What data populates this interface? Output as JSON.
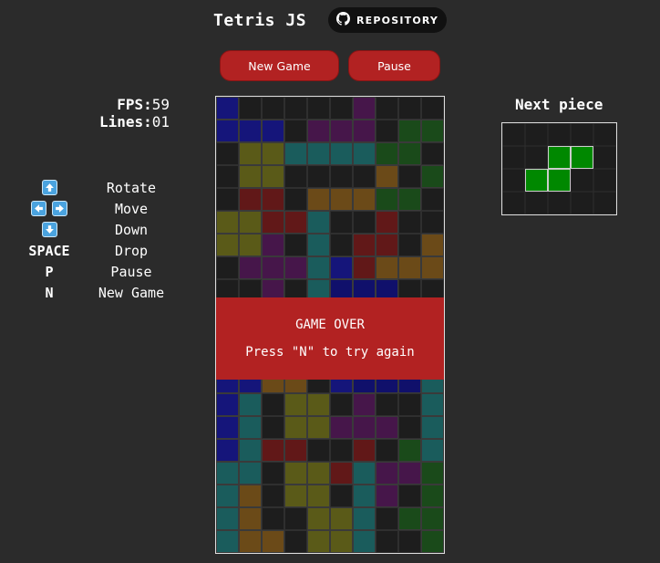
{
  "header": {
    "title": "Tetris JS",
    "repo_label": "REPOSITORY",
    "repo_icon": "github-icon"
  },
  "controls": {
    "new_game_label": "New Game",
    "pause_label": "Pause"
  },
  "stats": {
    "fps_label": "FPS:",
    "fps_value": "59",
    "lines_label": "Lines:",
    "lines_value": "01"
  },
  "keys": [
    {
      "key": "",
      "icons": [
        "arrow-up-icon"
      ],
      "action": "Rotate"
    },
    {
      "key": "",
      "icons": [
        "arrow-left-icon",
        "arrow-right-icon"
      ],
      "action": "Move"
    },
    {
      "key": "",
      "icons": [
        "arrow-down-icon"
      ],
      "action": "Down"
    },
    {
      "key": "SPACE",
      "icons": [],
      "action": "Drop"
    },
    {
      "key": "P",
      "icons": [],
      "action": "Pause"
    },
    {
      "key": "N",
      "icons": [],
      "action": "New Game"
    }
  ],
  "game_over": {
    "title": "GAME OVER",
    "message": "Press \"N\" to try again"
  },
  "next_piece": {
    "title": "Next piece",
    "shape": "S",
    "color": "#008800",
    "cells": [
      [
        2,
        1
      ],
      [
        3,
        1
      ],
      [
        1,
        2
      ],
      [
        2,
        2
      ]
    ]
  },
  "colors": {
    "empty": "#1d1d1d",
    "grid": "#2f2f2f",
    "B": "#15157a",
    "T": "#1a5c5c",
    "Y": "#5a5a18",
    "P": "#46164a",
    "R": "#611818",
    "O": "#6b4a18",
    "G": "#1a4a1a",
    "D": "#10106b"
  },
  "board": {
    "cols": 10,
    "rows": 20,
    "grid": [
      "B.....P...",
      "BBB.PPP.GG",
      ".YYTTTTGG.",
      ".YY....O.GG",
      ".RR.OOOGG.",
      "YYRRT..R..",
      "YYP.T.RR.O",
      ".PPPTBROOO",
      "..P.TDDD..",
      "..........",
      "..........",
      "..........",
      "BBOO.BDDDT",
      "BT.YY.P..T",
      "BT.YYPPP.T",
      "BTRR..R.GT",
      "TT.YYRTPPG",
      "TO.YY.TP.G",
      "TO..YYT.GG",
      "TOO.YYT..G"
    ]
  }
}
